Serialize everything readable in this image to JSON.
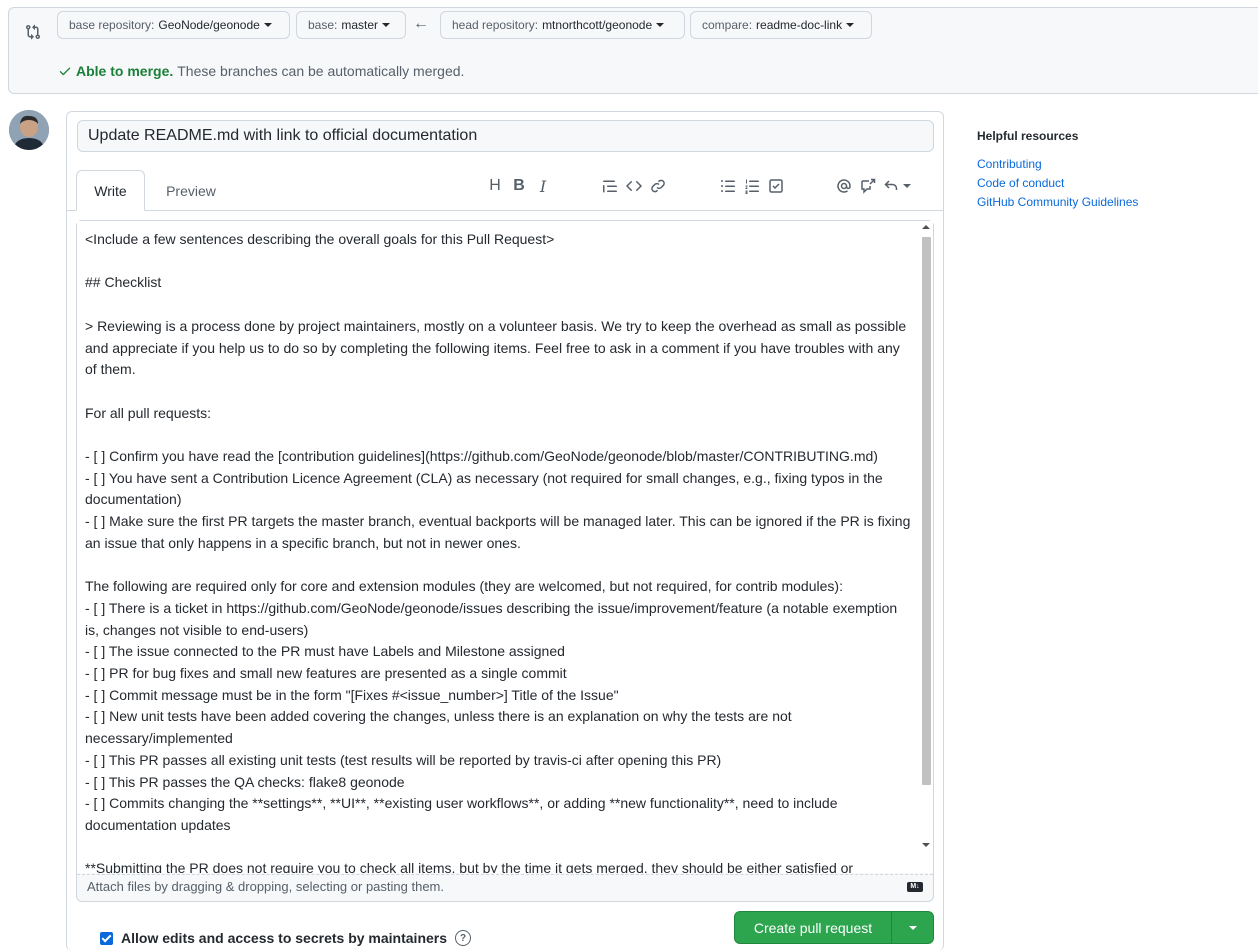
{
  "compare": {
    "base_repo_label": "base repository:",
    "base_repo_value": "GeoNode/geonode",
    "base_label": "base:",
    "base_value": "master",
    "arrow": "←",
    "head_repo_label": "head repository:",
    "head_repo_value": "mtnorthcott/geonode",
    "compare_label": "compare:",
    "compare_value": "readme-doc-link",
    "merge_ok": "Able to merge.",
    "merge_desc": "These branches can be automatically merged."
  },
  "form": {
    "title_value": "Update README.md with link to official documentation",
    "tab_write": "Write",
    "tab_preview": "Preview",
    "toolbar": {
      "heading": "H",
      "bold": "B",
      "italic": "I"
    },
    "body_text": "<Include a few sentences describing the overall goals for this Pull Request>\n\n## Checklist\n\n> Reviewing is a process done by project maintainers, mostly on a volunteer basis. We try to keep the overhead as small as possible and appreciate if you help us to do so by completing the following items. Feel free to ask in a comment if you have troubles with any of them.\n\nFor all pull requests:\n\n- [ ] Confirm you have read the [contribution guidelines](https://github.com/GeoNode/geonode/blob/master/CONTRIBUTING.md)\n- [ ] You have sent a Contribution Licence Agreement (CLA) as necessary (not required for small changes, e.g., fixing typos in the documentation)\n- [ ] Make sure the first PR targets the master branch, eventual backports will be managed later. This can be ignored if the PR is fixing an issue that only happens in a specific branch, but not in newer ones.\n\nThe following are required only for core and extension modules (they are welcomed, but not required, for contrib modules):\n- [ ] There is a ticket in https://github.com/GeoNode/geonode/issues describing the issue/improvement/feature (a notable exemption is, changes not visible to end-users)\n- [ ] The issue connected to the PR must have Labels and Milestone assigned\n- [ ] PR for bug fixes and small new features are presented as a single commit\n- [ ] Commit message must be in the form \"[Fixes #<issue_number>] Title of the Issue\"\n- [ ] New unit tests have been added covering the changes, unless there is an explanation on why the tests are not necessary/implemented\n- [ ] This PR passes all existing unit tests (test results will be reported by travis-ci after opening this PR)\n- [ ] This PR passes the QA checks: flake8 geonode\n- [ ] Commits changing the **settings**, **UI**, **existing user workflows**, or adding **new functionality**, need to include documentation updates\n\n**Submitting the PR does not require you to check all items, but by the time it gets merged, they should be either satisfied or",
    "attach_text": "Attach files by dragging & dropping, selecting or pasting them.",
    "markdown_badge": "M↓",
    "allow_edits_label": "Allow edits and access to secrets by maintainers",
    "help_glyph": "?",
    "create_button": "Create pull request"
  },
  "sidebar": {
    "title": "Helpful resources",
    "links": [
      "Contributing",
      "Code of conduct",
      "GitHub Community Guidelines"
    ]
  },
  "colors": {
    "accent": "#0969da",
    "success": "#1a7f37",
    "button_green": "#2da44e"
  }
}
